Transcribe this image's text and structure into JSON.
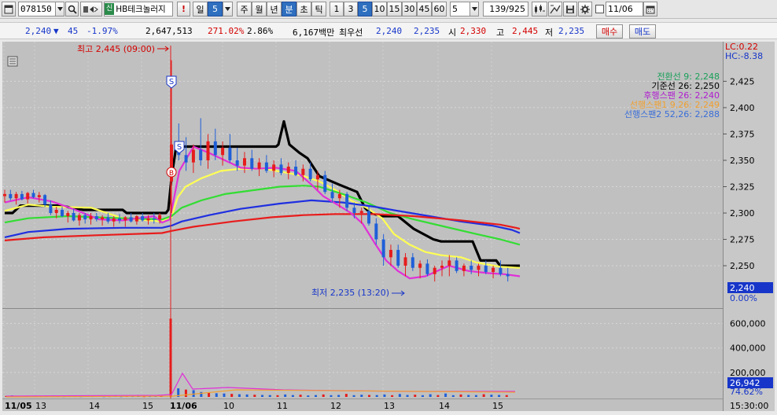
{
  "toolbar": {
    "code": "078150",
    "stock_badge": "신",
    "stock_name": "HB테크놀러지",
    "period_day": "일",
    "period_day_value": "5",
    "period_week": "주",
    "period_month": "월",
    "period_year": "년",
    "period_minute": "분",
    "period_second": "초",
    "period_tick": "틱",
    "minute_buttons": [
      "1",
      "3",
      "5",
      "10",
      "15",
      "30",
      "45",
      "60"
    ],
    "minute_selected": "5",
    "minute_value": "5",
    "count": "139/925",
    "date_value": "11/06"
  },
  "quote": {
    "price": "2,240",
    "change_arrow": "▼",
    "change": "45",
    "change_pct": "-1.97%",
    "volume": "2,647,513",
    "volume_ratio": "271.02%",
    "turnover": "2.86%",
    "amount": "6,167백만",
    "ask_label": "최우선",
    "ask": "2,240",
    "bid": "2,235",
    "open_label": "시",
    "open": "2,330",
    "high_label": "고",
    "high": "2,445",
    "low_label": "저",
    "low": "2,235",
    "buy_label": "매수",
    "sell_label": "매도"
  },
  "chart_data": {
    "type": "candlestick",
    "price_axis": {
      "min": 2215,
      "max": 2435,
      "ticks": [
        2425,
        2400,
        2375,
        2350,
        2325,
        2300,
        2275,
        2250
      ]
    },
    "volume_axis": {
      "max": 700000,
      "ticks": [
        "600,000",
        "400,000",
        "200,000"
      ]
    },
    "lc_label": "LC:0.22",
    "hc_label": "HC:-8.38",
    "current_price_tag": "2,240",
    "current_pct_tag": "0.00%",
    "current_volume_tag": "26,942",
    "volume_pct_tag": "74.62%",
    "high_annotation": "최고 2,445 (09:00)",
    "low_annotation": "최저 2,235 (13:20)",
    "signals": [
      "S",
      "S",
      "B"
    ],
    "legend": [
      {
        "label": "전환선 9: 2,248",
        "color": "#1aa05a"
      },
      {
        "label": "기준선 26: 2,250",
        "color": "#000000"
      },
      {
        "label": "후행스팬 26: 2,240",
        "color": "#b01cd0"
      },
      {
        "label": "선행스팬1 9,26: 2,249",
        "color": "#f0a030"
      },
      {
        "label": "선행스팬2 52,26: 2,288",
        "color": "#3a6ed8"
      }
    ],
    "x_labels": [
      {
        "label": "11/05",
        "bold": true
      },
      {
        "label": "13",
        "bold": false
      },
      {
        "label": "14",
        "bold": false
      },
      {
        "label": "15",
        "bold": false
      },
      {
        "label": "11/06",
        "bold": true
      },
      {
        "label": "10",
        "bold": false
      },
      {
        "label": "11",
        "bold": false
      },
      {
        "label": "12",
        "bold": false
      },
      {
        "label": "13",
        "bold": false
      },
      {
        "label": "14",
        "bold": false
      },
      {
        "label": "15",
        "bold": false
      }
    ],
    "time_label": "15:30:00",
    "series": [
      {
        "name": "기준선",
        "color": "#000000",
        "points": [
          [
            2300,
            0
          ],
          [
            2300,
            10
          ],
          [
            2307,
            20
          ],
          [
            2307,
            70
          ],
          [
            2303,
            100
          ],
          [
            2303,
            150
          ],
          [
            2300,
            155
          ],
          [
            2300,
            205
          ],
          [
            2303,
            208
          ],
          [
            2333,
            212
          ],
          [
            2363,
            218
          ],
          [
            2363,
            345
          ],
          [
            2365,
            348
          ],
          [
            2387,
            355
          ],
          [
            2365,
            362
          ],
          [
            2357,
            375
          ],
          [
            2352,
            385
          ],
          [
            2335,
            400
          ],
          [
            2327,
            425
          ],
          [
            2320,
            448
          ],
          [
            2305,
            458
          ],
          [
            2300,
            465
          ],
          [
            2297,
            480
          ],
          [
            2297,
            500
          ],
          [
            2285,
            520
          ],
          [
            2275,
            545
          ],
          [
            2273,
            555
          ],
          [
            2273,
            595
          ],
          [
            2255,
            605
          ],
          [
            2255,
            625
          ],
          [
            2250,
            630
          ],
          [
            2250,
            655
          ]
        ]
      },
      {
        "name": "전환선",
        "color": "#ffff55",
        "points": [
          [
            2302,
            0
          ],
          [
            2308,
            30
          ],
          [
            2306,
            60
          ],
          [
            2305,
            110
          ],
          [
            2295,
            150
          ],
          [
            2292,
            200
          ],
          [
            2296,
            212
          ],
          [
            2315,
            220
          ],
          [
            2325,
            230
          ],
          [
            2333,
            250
          ],
          [
            2340,
            275
          ],
          [
            2342,
            300
          ],
          [
            2342,
            330
          ],
          [
            2338,
            360
          ],
          [
            2335,
            380
          ],
          [
            2330,
            400
          ],
          [
            2322,
            420
          ],
          [
            2312,
            440
          ],
          [
            2305,
            460
          ],
          [
            2295,
            480
          ],
          [
            2280,
            495
          ],
          [
            2270,
            515
          ],
          [
            2263,
            535
          ],
          [
            2260,
            555
          ],
          [
            2258,
            580
          ],
          [
            2253,
            600
          ],
          [
            2249,
            630
          ],
          [
            2248,
            655
          ]
        ]
      },
      {
        "name": "MA1",
        "color": "#33dd33",
        "points": [
          [
            2291,
            0
          ],
          [
            2295,
            30
          ],
          [
            2297,
            80
          ],
          [
            2295,
            150
          ],
          [
            2294,
            200
          ],
          [
            2297,
            212
          ],
          [
            2305,
            225
          ],
          [
            2312,
            250
          ],
          [
            2318,
            280
          ],
          [
            2322,
            320
          ],
          [
            2325,
            350
          ],
          [
            2326,
            380
          ],
          [
            2325,
            400
          ],
          [
            2318,
            430
          ],
          [
            2310,
            460
          ],
          [
            2300,
            490
          ],
          [
            2294,
            520
          ],
          [
            2287,
            560
          ],
          [
            2280,
            600
          ],
          [
            2275,
            630
          ],
          [
            2270,
            655
          ]
        ]
      },
      {
        "name": "MA2",
        "color": "#1f2fe0",
        "points": [
          [
            2277,
            0
          ],
          [
            2282,
            30
          ],
          [
            2285,
            80
          ],
          [
            2286,
            150
          ],
          [
            2286,
            200
          ],
          [
            2288,
            212
          ],
          [
            2292,
            225
          ],
          [
            2298,
            260
          ],
          [
            2304,
            300
          ],
          [
            2309,
            350
          ],
          [
            2312,
            390
          ],
          [
            2310,
            430
          ],
          [
            2306,
            470
          ],
          [
            2302,
            500
          ],
          [
            2297,
            540
          ],
          [
            2292,
            580
          ],
          [
            2288,
            620
          ],
          [
            2284,
            645
          ],
          [
            2281,
            655
          ]
        ]
      },
      {
        "name": "MA3",
        "color": "#e81c1c",
        "points": [
          [
            2274,
            0
          ],
          [
            2277,
            50
          ],
          [
            2279,
            120
          ],
          [
            2281,
            200
          ],
          [
            2283,
            212
          ],
          [
            2287,
            240
          ],
          [
            2292,
            290
          ],
          [
            2296,
            340
          ],
          [
            2298,
            380
          ],
          [
            2299,
            420
          ],
          [
            2299,
            470
          ],
          [
            2297,
            520
          ],
          [
            2293,
            580
          ],
          [
            2289,
            630
          ],
          [
            2286,
            650
          ],
          [
            2285,
            655
          ]
        ]
      },
      {
        "name": "후행스팬",
        "color": "#e030d8",
        "points": [
          [
            2310,
            0
          ],
          [
            2315,
            30
          ],
          [
            2311,
            60
          ],
          [
            2303,
            90
          ],
          [
            2294,
            120
          ],
          [
            2293,
            150
          ],
          [
            2297,
            190
          ],
          [
            2291,
            200
          ],
          [
            2294,
            210
          ],
          [
            2340,
            222
          ],
          [
            2363,
            240
          ],
          [
            2357,
            260
          ],
          [
            2350,
            280
          ],
          [
            2343,
            300
          ],
          [
            2342,
            320
          ],
          [
            2343,
            345
          ],
          [
            2340,
            370
          ],
          [
            2327,
            390
          ],
          [
            2316,
            405
          ],
          [
            2307,
            425
          ],
          [
            2300,
            440
          ],
          [
            2290,
            455
          ],
          [
            2272,
            470
          ],
          [
            2255,
            485
          ],
          [
            2245,
            500
          ],
          [
            2238,
            515
          ],
          [
            2240,
            535
          ],
          [
            2245,
            550
          ],
          [
            2250,
            565
          ],
          [
            2245,
            590
          ],
          [
            2243,
            615
          ],
          [
            2242,
            635
          ],
          [
            2240,
            655
          ]
        ]
      }
    ],
    "candles": [
      [
        2316,
        2322,
        2310,
        2318
      ],
      [
        2318,
        2322,
        2312,
        2314
      ],
      [
        2314,
        2320,
        2308,
        2318
      ],
      [
        2318,
        2321,
        2312,
        2313
      ],
      [
        2313,
        2320,
        2309,
        2319
      ],
      [
        2319,
        2322,
        2314,
        2315
      ],
      [
        2315,
        2320,
        2310,
        2317
      ],
      [
        2317,
        2318,
        2306,
        2308
      ],
      [
        2308,
        2312,
        2298,
        2300
      ],
      [
        2300,
        2306,
        2295,
        2303
      ],
      [
        2303,
        2306,
        2296,
        2297
      ],
      [
        2297,
        2302,
        2291,
        2300
      ],
      [
        2300,
        2304,
        2292,
        2293
      ],
      [
        2293,
        2300,
        2288,
        2298
      ],
      [
        2298,
        2300,
        2290,
        2294
      ],
      [
        2294,
        2300,
        2289,
        2297
      ],
      [
        2297,
        2300,
        2292,
        2294
      ],
      [
        2294,
        2298,
        2288,
        2296
      ],
      [
        2296,
        2300,
        2290,
        2292
      ],
      [
        2292,
        2297,
        2287,
        2295
      ],
      [
        2295,
        2299,
        2290,
        2293
      ],
      [
        2293,
        2297,
        2287,
        2296
      ],
      [
        2296,
        2300,
        2291,
        2292
      ],
      [
        2292,
        2298,
        2289,
        2297
      ],
      [
        2297,
        2300,
        2292,
        2293
      ],
      [
        2293,
        2298,
        2289,
        2295
      ],
      [
        2295,
        2300,
        2290,
        2294
      ],
      [
        2294,
        2300,
        2290,
        2298
      ],
      [
        2330,
        2445,
        2300,
        2365
      ],
      [
        2365,
        2385,
        2350,
        2355
      ],
      [
        2355,
        2372,
        2340,
        2348
      ],
      [
        2348,
        2365,
        2338,
        2360
      ],
      [
        2360,
        2390,
        2345,
        2350
      ],
      [
        2350,
        2375,
        2342,
        2368
      ],
      [
        2368,
        2380,
        2350,
        2355
      ],
      [
        2355,
        2368,
        2345,
        2362
      ],
      [
        2362,
        2375,
        2348,
        2350
      ],
      [
        2350,
        2362,
        2340,
        2345
      ],
      [
        2345,
        2358,
        2338,
        2352
      ],
      [
        2352,
        2360,
        2340,
        2342
      ],
      [
        2342,
        2352,
        2335,
        2348
      ],
      [
        2348,
        2355,
        2338,
        2340
      ],
      [
        2340,
        2350,
        2334,
        2346
      ],
      [
        2346,
        2352,
        2336,
        2338
      ],
      [
        2338,
        2348,
        2332,
        2344
      ],
      [
        2344,
        2350,
        2335,
        2336
      ],
      [
        2336,
        2346,
        2330,
        2342
      ],
      [
        2342,
        2348,
        2330,
        2332
      ],
      [
        2332,
        2340,
        2322,
        2336
      ],
      [
        2336,
        2340,
        2318,
        2320
      ],
      [
        2320,
        2328,
        2310,
        2314
      ],
      [
        2314,
        2322,
        2305,
        2318
      ],
      [
        2318,
        2320,
        2302,
        2305
      ],
      [
        2305,
        2310,
        2295,
        2300
      ],
      [
        2300,
        2305,
        2290,
        2302
      ],
      [
        2302,
        2306,
        2288,
        2290
      ],
      [
        2290,
        2295,
        2270,
        2275
      ],
      [
        2275,
        2280,
        2250,
        2258
      ],
      [
        2258,
        2270,
        2250,
        2265
      ],
      [
        2265,
        2270,
        2248,
        2250
      ],
      [
        2250,
        2262,
        2240,
        2258
      ],
      [
        2258,
        2262,
        2245,
        2248
      ],
      [
        2248,
        2255,
        2238,
        2252
      ],
      [
        2252,
        2256,
        2240,
        2242
      ],
      [
        2242,
        2250,
        2235,
        2248
      ],
      [
        2248,
        2255,
        2240,
        2250
      ],
      [
        2250,
        2260,
        2240,
        2255
      ],
      [
        2255,
        2258,
        2243,
        2245
      ],
      [
        2245,
        2252,
        2240,
        2250
      ],
      [
        2250,
        2255,
        2242,
        2246
      ],
      [
        2246,
        2252,
        2240,
        2250
      ],
      [
        2250,
        2255,
        2242,
        2244
      ],
      [
        2244,
        2250,
        2238,
        2248
      ],
      [
        2248,
        2255,
        2240,
        2242
      ],
      [
        2242,
        2248,
        2235,
        2240
      ]
    ],
    "volumes": [
      8,
      12,
      6,
      9,
      5,
      7,
      6,
      10,
      8,
      6,
      5,
      7,
      6,
      5,
      8,
      6,
      7,
      5,
      6,
      8,
      5,
      7,
      6,
      9,
      5,
      6,
      8,
      7,
      640,
      70,
      60,
      55,
      40,
      35,
      30,
      28,
      25,
      22,
      20,
      18,
      16,
      15,
      14,
      20,
      15,
      18,
      12,
      15,
      20,
      14,
      16,
      25,
      14,
      18,
      16,
      15,
      20,
      14,
      24,
      16,
      18,
      14,
      22,
      15,
      28,
      14,
      20,
      16,
      15,
      22,
      18,
      16,
      15
    ]
  }
}
